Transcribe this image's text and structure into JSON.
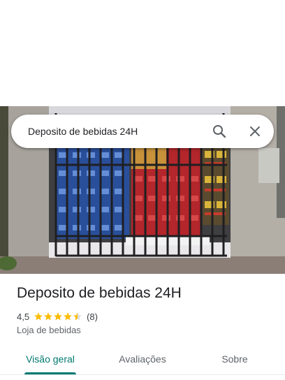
{
  "search": {
    "query": "Deposito de bebidas 24H",
    "search_icon": "search-icon",
    "close_icon": "close-icon"
  },
  "place": {
    "name": "Deposito de bebidas 24H",
    "rating": "4,5",
    "rating_stars": 4.5,
    "review_count": "(8)",
    "category": "Loja de bebidas"
  },
  "tabs": [
    {
      "label": "Visão geral",
      "active": true
    },
    {
      "label": "Avaliações",
      "active": false
    },
    {
      "label": "Sobre",
      "active": false
    }
  ],
  "colors": {
    "accent": "#01796f",
    "star": "#fbbc04",
    "star_empty": "#dadce0"
  }
}
